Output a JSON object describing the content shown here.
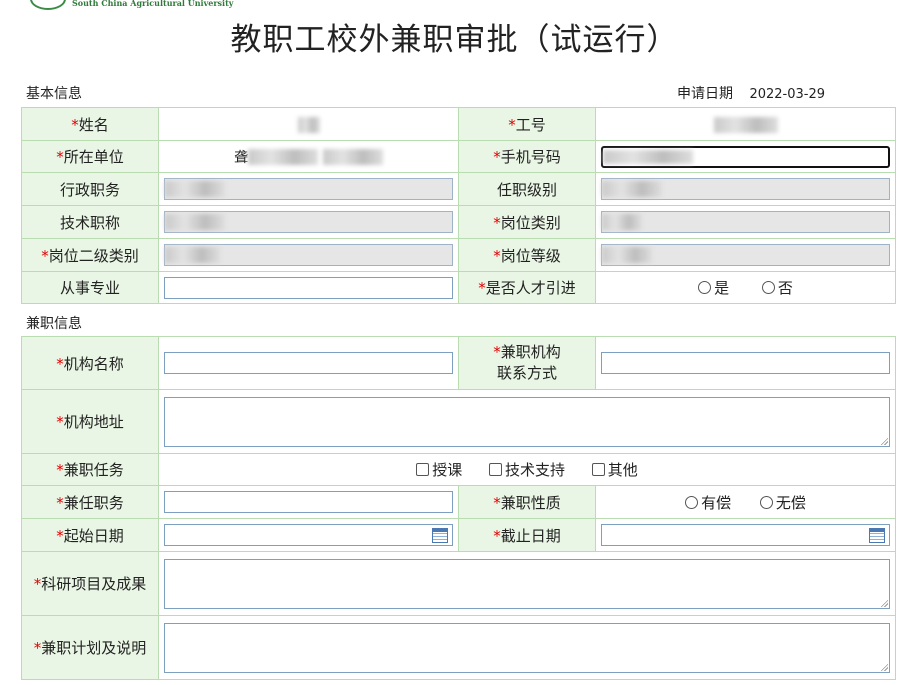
{
  "header": {
    "university_en": "South China Agricultural University",
    "title": "教职工校外兼职审批（试运行）"
  },
  "basic": {
    "section_title": "基本信息",
    "apply_date_label": "申请日期",
    "apply_date_value": "2022-03-29",
    "name_label": "姓名",
    "staff_no_label": "工号",
    "unit_label": "所在单位",
    "unit_prefix": "聋",
    "phone_label": "手机号码",
    "admin_post_label": "行政职务",
    "level_label": "任职级别",
    "tech_title_label": "技术职称",
    "post_type_label": "岗位类别",
    "post_subtype_label": "岗位二级类别",
    "post_grade_label": "岗位等级",
    "major_label": "从事专业",
    "talent_label": "是否人才引进",
    "yes": "是",
    "no": "否"
  },
  "parttime": {
    "section_title": "兼职信息",
    "org_name_label": "机构名称",
    "org_contact_label_1": "兼职机构",
    "org_contact_label_2": "联系方式",
    "org_addr_label": "机构地址",
    "task_label": "兼职任务",
    "task_teach": "授课",
    "task_tech": "技术支持",
    "task_other": "其他",
    "post_label": "兼任职务",
    "nature_label": "兼职性质",
    "paid": "有偿",
    "unpaid": "无偿",
    "start_label": "起始日期",
    "end_label": "截止日期",
    "research_label": "科研项目及成果",
    "plan_label": "兼职计划及说明"
  },
  "required_mark": "*"
}
